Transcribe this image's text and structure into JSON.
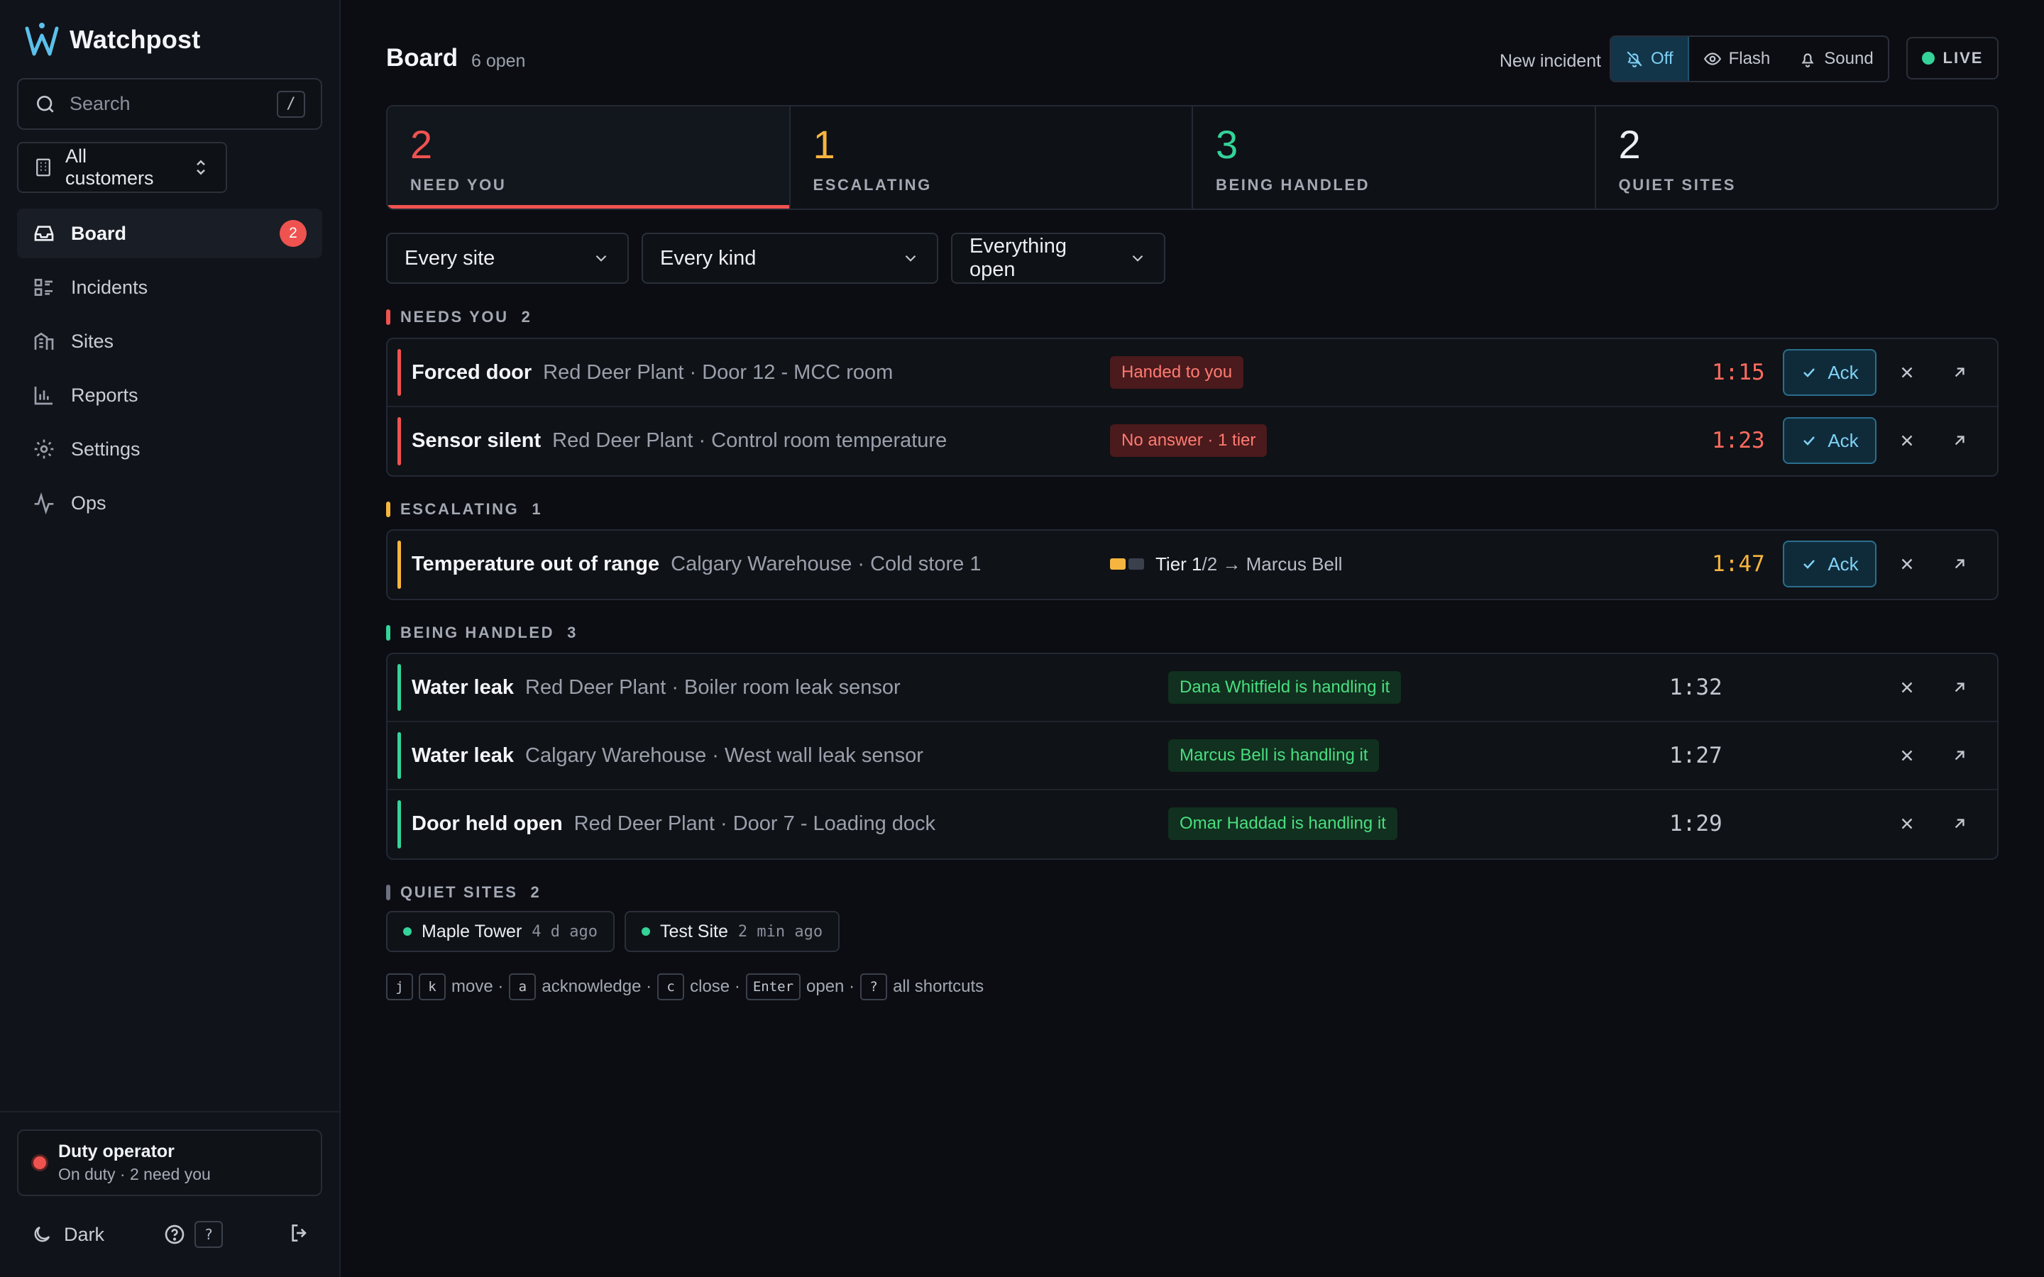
{
  "brand": {
    "name": "Watchpost"
  },
  "search": {
    "placeholder": "Search",
    "shortcut": "/"
  },
  "customers": {
    "label": "All customers"
  },
  "nav": [
    {
      "label": "Board",
      "badge": "2",
      "icon": "inbox-icon"
    },
    {
      "label": "Incidents",
      "icon": "list-icon"
    },
    {
      "label": "Sites",
      "icon": "building-icon"
    },
    {
      "label": "Reports",
      "icon": "bar-chart-icon"
    },
    {
      "label": "Settings",
      "icon": "gear-icon"
    },
    {
      "label": "Ops",
      "icon": "activity-icon"
    }
  ],
  "duty": {
    "title": "Duty operator",
    "subtitle": "On duty · 2 need you"
  },
  "footer": {
    "theme": "Dark",
    "help_key": "?"
  },
  "header": {
    "title": "Board",
    "open_count": "6 open",
    "notify_label": "New incident",
    "notify_options": [
      "Off",
      "Flash",
      "Sound"
    ],
    "live": "LIVE"
  },
  "stats": [
    {
      "value": "2",
      "label": "NEED YOU",
      "color": "#ef5350"
    },
    {
      "value": "1",
      "label": "ESCALATING",
      "color": "#f6b53f"
    },
    {
      "value": "3",
      "label": "BEING HANDLED",
      "color": "#34d399"
    },
    {
      "value": "2",
      "label": "QUIET SITES",
      "color": "#eceef2"
    }
  ],
  "filters": [
    "Every site",
    "Every kind",
    "Everything open"
  ],
  "sections": {
    "need_you": {
      "title": "NEEDS YOU",
      "count": "2",
      "color": "#ef5350"
    },
    "escalating": {
      "title": "ESCALATING",
      "count": "1",
      "color": "#f6b53f"
    },
    "handled": {
      "title": "BEING HANDLED",
      "count": "3",
      "color": "#34d399"
    },
    "quiet": {
      "title": "QUIET SITES",
      "count": "2",
      "color": "#6b7180"
    }
  },
  "need_you": [
    {
      "kind": "Forced door",
      "location": "Red Deer Plant · Door 12 - MCC room",
      "status": "Handed to you",
      "timer": "1:15",
      "ack": "Ack"
    },
    {
      "kind": "Sensor silent",
      "location": "Red Deer Plant · Control room temperature",
      "status": "No answer · 1 tier",
      "timer": "1:23",
      "ack": "Ack"
    }
  ],
  "escalating": [
    {
      "kind": "Temperature out of range",
      "location": "Calgary Warehouse · Cold store 1",
      "tier_current": "Tier 1",
      "tier_rest": "/2 → Marcus Bell",
      "tier_level": 1,
      "tier_total": 2,
      "timer": "1:47",
      "ack": "Ack"
    }
  ],
  "handled": [
    {
      "kind": "Water leak",
      "location": "Red Deer Plant · Boiler room leak sensor",
      "status": "Dana Whitfield is handling it",
      "timer": "1:32"
    },
    {
      "kind": "Water leak",
      "location": "Calgary Warehouse · West wall leak sensor",
      "status": "Marcus Bell is handling it",
      "timer": "1:27"
    },
    {
      "kind": "Door held open",
      "location": "Red Deer Plant · Door 7 - Loading dock",
      "status": "Omar Haddad is handling it",
      "timer": "1:29"
    }
  ],
  "quiet_sites": [
    {
      "name": "Maple Tower",
      "ago": "4 d ago"
    },
    {
      "name": "Test Site",
      "ago": "2 min ago"
    }
  ],
  "shortcuts": [
    {
      "keys": [
        "j",
        "k"
      ],
      "label": "move ·"
    },
    {
      "keys": [
        "a"
      ],
      "label": "acknowledge ·"
    },
    {
      "keys": [
        "c"
      ],
      "label": "close ·"
    },
    {
      "keys": [
        "Enter"
      ],
      "label": "open ·"
    },
    {
      "keys": [
        "?"
      ],
      "label": "all shortcuts"
    }
  ]
}
